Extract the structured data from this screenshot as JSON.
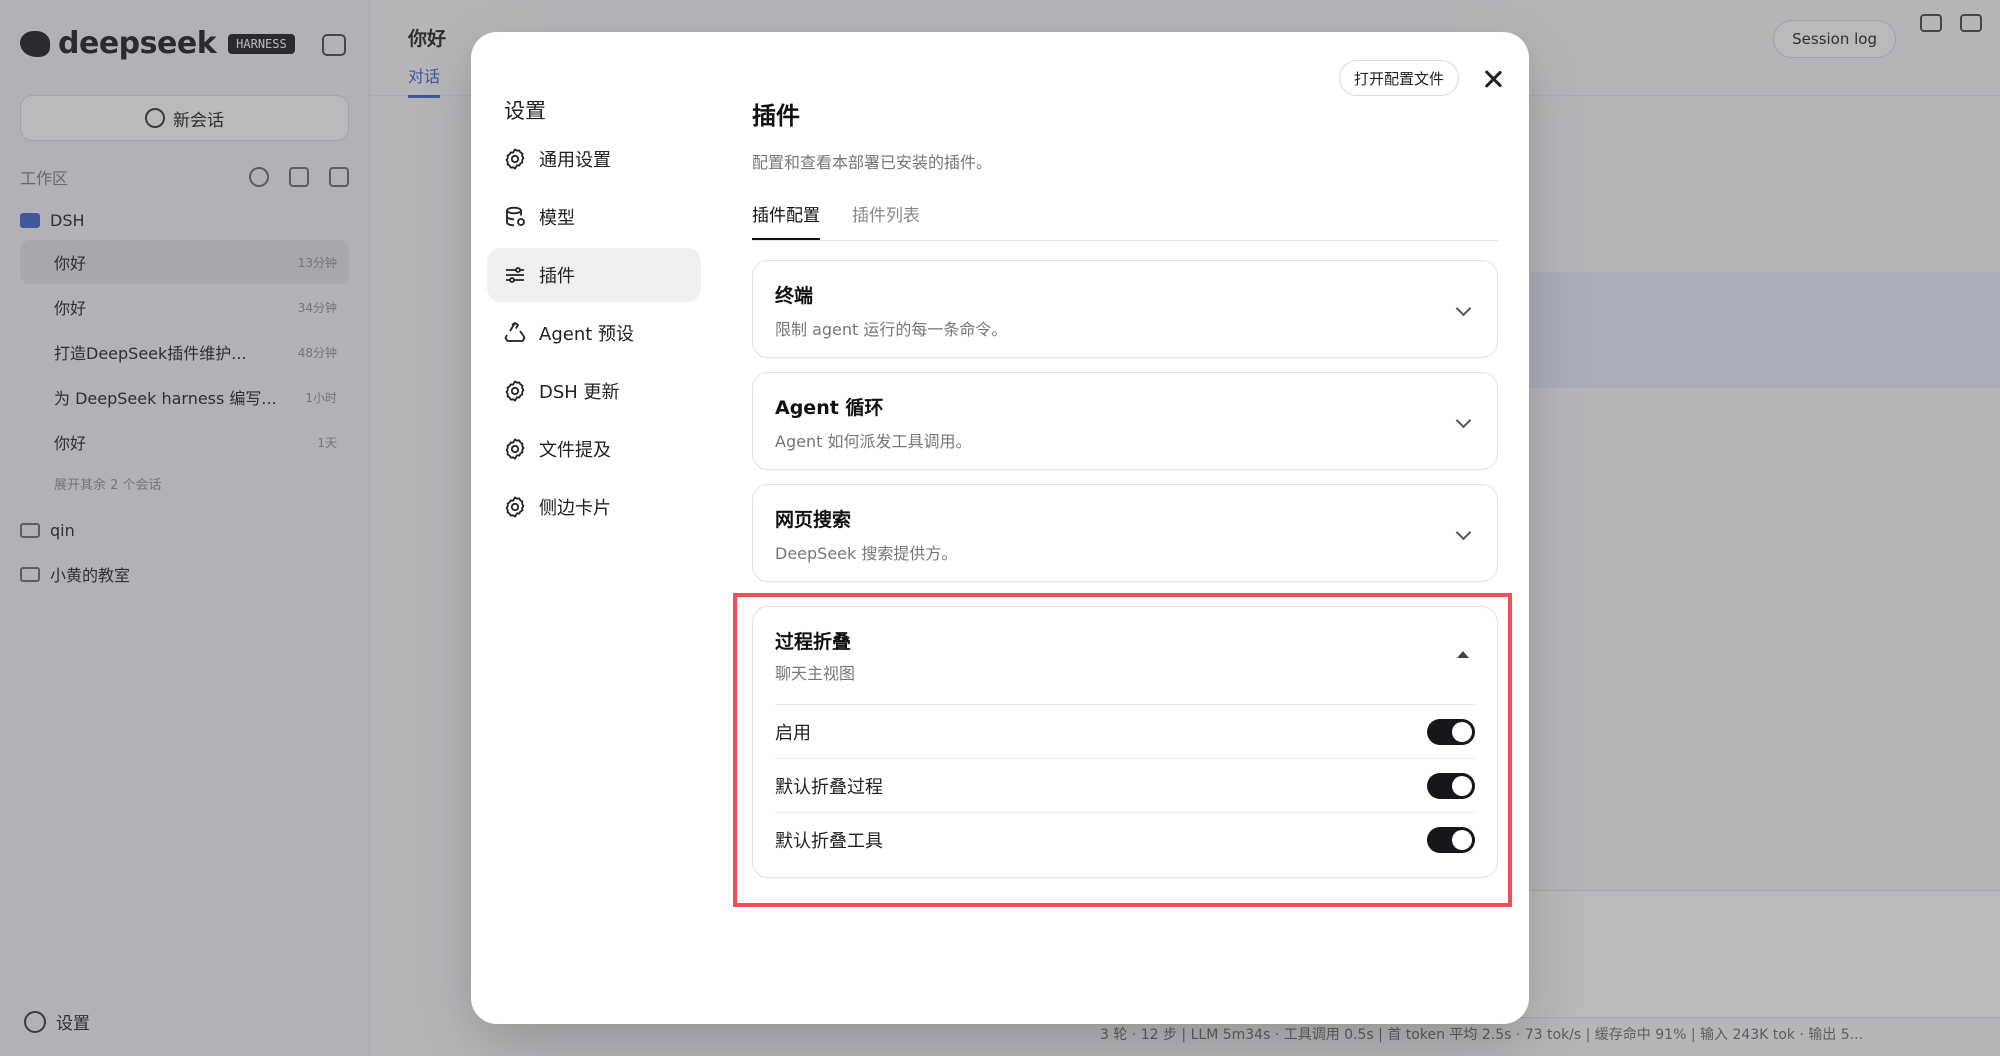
{
  "background": {
    "logo_text": "deepseek",
    "logo_badge": "HARNESS",
    "new_chat_label": "新会话",
    "workspace_label": "工作区",
    "folders": [
      {
        "name": "DSH"
      },
      {
        "name": "qin"
      },
      {
        "name": "小黄的教室"
      }
    ],
    "chats": [
      {
        "title": "你好",
        "time": "13分钟"
      },
      {
        "title": "你好",
        "time": "34分钟"
      },
      {
        "title": "打造DeepSeek插件维护...",
        "time": "48分钟"
      },
      {
        "title": "为 DeepSeek harness 编写...",
        "time": "1小时"
      },
      {
        "title": "你好",
        "time": "1天"
      }
    ],
    "more_sessions": "展开其余 2 个会话",
    "settings_label": "设置",
    "main_title": "你好",
    "main_tab": "对话",
    "session_log": "Session log",
    "status_bar": "3 轮 · 12 步  |  LLM 5m34s · 工具调用 0.5s  |  首 token 平均 2.5s · 73 tok/s  |  缓存命中 91%  |  输入 243K tok · 输出 5..."
  },
  "modal": {
    "title": "设置",
    "open_config_label": "打开配置文件",
    "nav": [
      {
        "label": "通用设置",
        "icon": "gear-icon",
        "active": false
      },
      {
        "label": "模型",
        "icon": "database-icon",
        "active": false
      },
      {
        "label": "插件",
        "icon": "sliders-icon",
        "active": true
      },
      {
        "label": "Agent 预设",
        "icon": "recycle-icon",
        "active": false
      },
      {
        "label": "DSH 更新",
        "icon": "gear-icon",
        "active": false
      },
      {
        "label": "文件提及",
        "icon": "gear-icon",
        "active": false
      },
      {
        "label": "侧边卡片",
        "icon": "gear-icon",
        "active": false
      }
    ],
    "content": {
      "title": "插件",
      "description": "配置和查看本部署已安装的插件。",
      "tabs": [
        {
          "label": "插件配置",
          "active": true
        },
        {
          "label": "插件列表",
          "active": false
        }
      ],
      "cards": [
        {
          "title": "终端",
          "description": "限制 agent 运行的每一条命令。"
        },
        {
          "title": "Agent 循环",
          "description": "Agent 如何派发工具调用。"
        },
        {
          "title": "网页搜索",
          "description": "DeepSeek 搜索提供方。"
        }
      ],
      "expanded_card": {
        "title": "过程折叠",
        "description": "聊天主视图",
        "settings": [
          {
            "label": "启用",
            "enabled": true
          },
          {
            "label": "默认折叠过程",
            "enabled": true
          },
          {
            "label": "默认折叠工具",
            "enabled": true
          }
        ]
      }
    }
  },
  "colors": {
    "highlight": "#ec4f57",
    "toggle_on": "#16161a",
    "accent": "#4a6fd6"
  }
}
